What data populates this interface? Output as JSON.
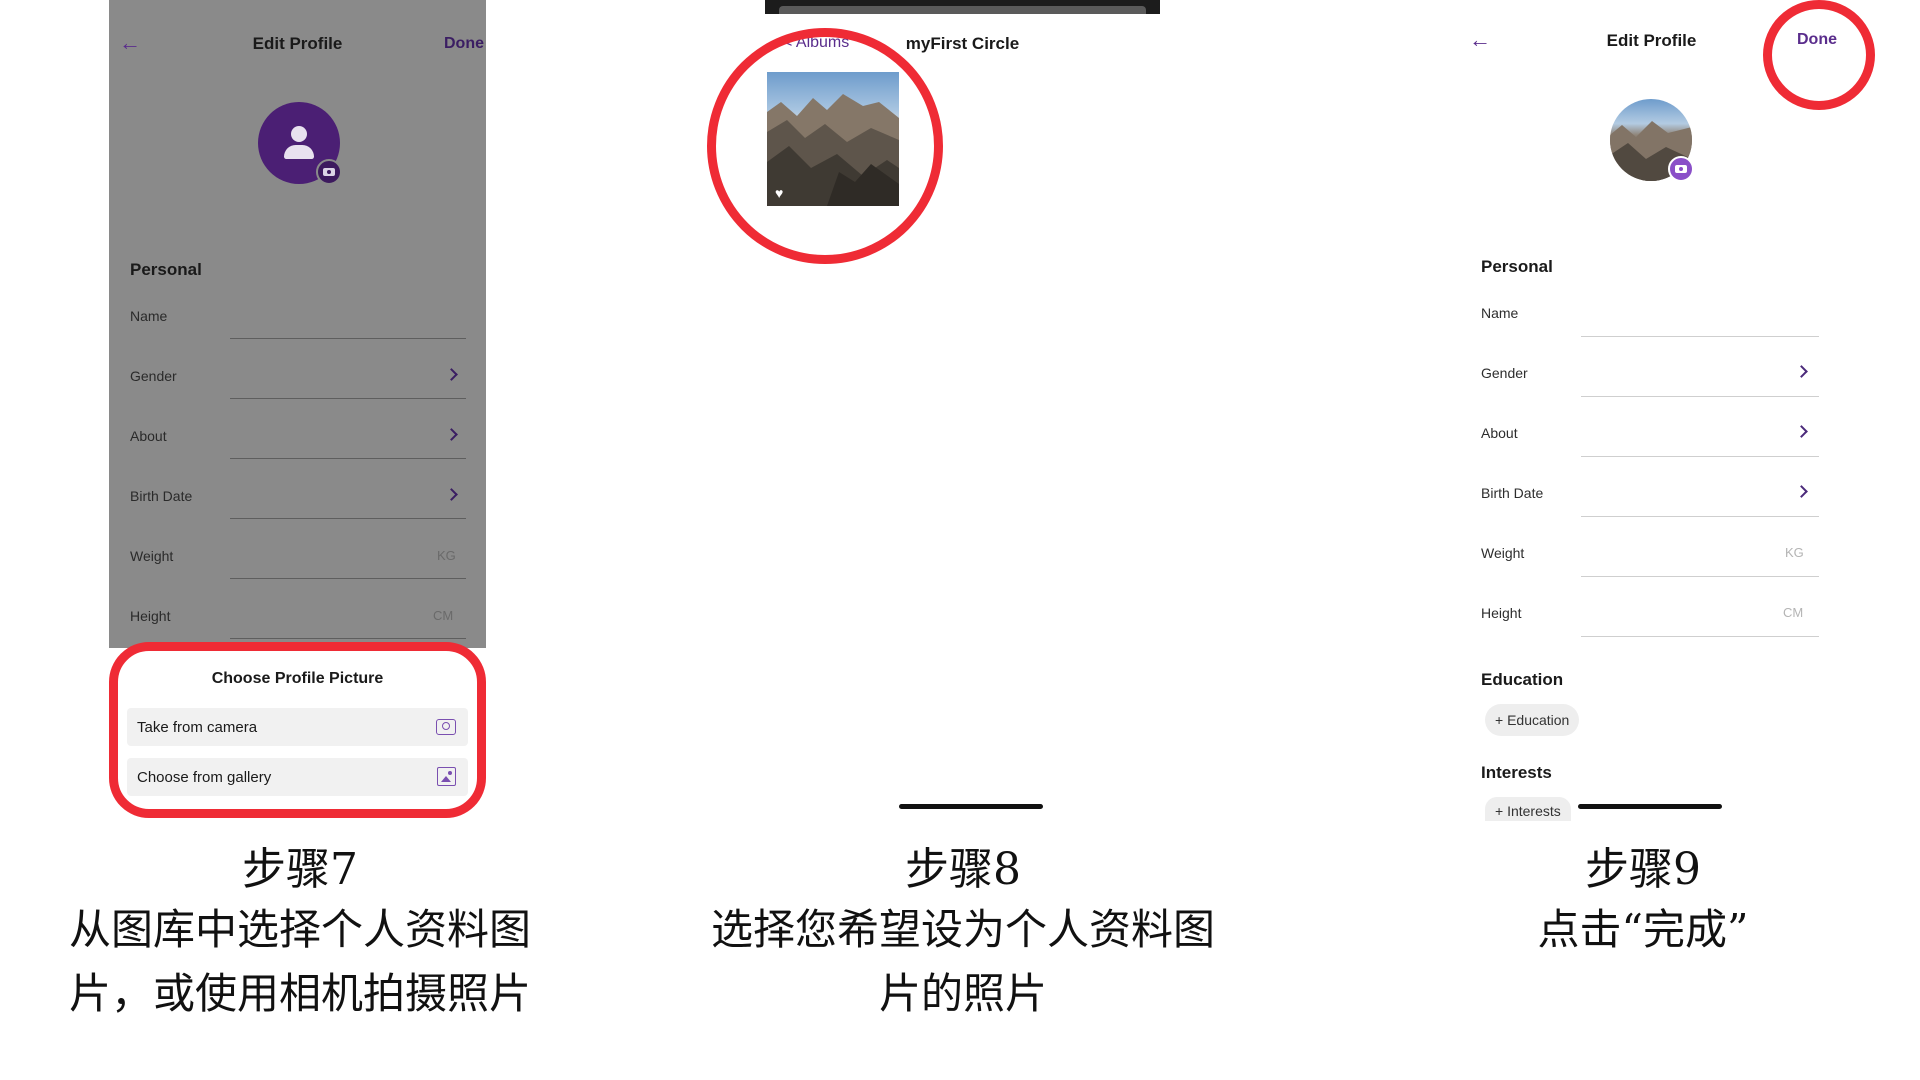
{
  "panel1": {
    "topbar": {
      "back_icon": "arrow-left-icon",
      "title": "Edit Profile",
      "done_label": "Done"
    },
    "avatar_icon": "person-icon",
    "section_personal": "Personal",
    "fields": [
      {
        "label": "Name",
        "kind": "text"
      },
      {
        "label": "Gender",
        "kind": "select"
      },
      {
        "label": "About",
        "kind": "select"
      },
      {
        "label": "Birth Date",
        "kind": "select"
      },
      {
        "label": "Weight",
        "kind": "unit",
        "unit": "KG"
      },
      {
        "label": "Height",
        "kind": "unit",
        "unit": "CM"
      }
    ],
    "sheet": {
      "title": "Choose Profile Picture",
      "options": [
        {
          "label": "Take from camera",
          "icon": "camera-icon"
        },
        {
          "label": "Choose from gallery",
          "icon": "gallery-icon"
        }
      ]
    },
    "caption": {
      "step": "步骤7",
      "lines": [
        "从图库中选择个人资料图",
        "片，或使用相机拍摄照片"
      ]
    }
  },
  "panel2": {
    "back_label": "< Albums",
    "title": "myFirst Circle",
    "photo_icon": "heart-icon",
    "caption": {
      "step": "步骤8",
      "lines": [
        "选择您希望设为个人资料图",
        "片的照片"
      ]
    }
  },
  "panel3": {
    "topbar": {
      "back_icon": "arrow-left-icon",
      "title": "Edit Profile",
      "done_label": "Done"
    },
    "section_personal": "Personal",
    "fields": [
      {
        "label": "Name",
        "kind": "text"
      },
      {
        "label": "Gender",
        "kind": "select"
      },
      {
        "label": "About",
        "kind": "select"
      },
      {
        "label": "Birth Date",
        "kind": "select"
      },
      {
        "label": "Weight",
        "kind": "unit",
        "unit": "KG"
      },
      {
        "label": "Height",
        "kind": "unit",
        "unit": "CM"
      }
    ],
    "section_education": "Education",
    "education_chip": "+ Education",
    "section_interests": "Interests",
    "interests_chip": "+ Interests",
    "caption": {
      "step": "步骤9",
      "lines": [
        "点击“完成”"
      ]
    }
  },
  "colors": {
    "accent": "#5a2d8c",
    "highlight_ring": "#ef2b35",
    "dim_overlay": "#8a8a8a"
  }
}
